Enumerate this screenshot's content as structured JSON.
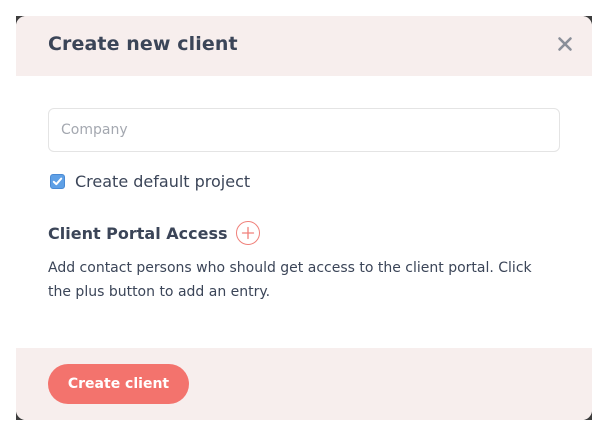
{
  "dialog": {
    "title": "Create new client",
    "close_icon": "close-icon"
  },
  "form": {
    "company": {
      "value": "",
      "placeholder": "Company"
    },
    "default_project": {
      "label": "Create default project",
      "checked": true
    }
  },
  "portal": {
    "heading": "Client Portal Access",
    "add_icon": "plus-circle-icon",
    "description": "Add contact persons who should get access to the client portal. Click the plus button to add an entry."
  },
  "footer": {
    "create_label": "Create client"
  },
  "colors": {
    "accent": "#f3736d",
    "header_bg": "#f7eeed",
    "text": "#3b4558",
    "checkbox": "#5fa0e6"
  }
}
